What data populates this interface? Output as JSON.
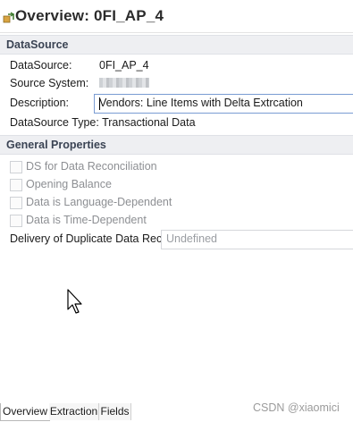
{
  "title": "Overview: 0FI_AP_4",
  "icons": {
    "title": "datasource-icon"
  },
  "datasource_section": {
    "header": "DataSource",
    "fields": {
      "datasource": {
        "label": "DataSource:",
        "value": "0FI_AP_4"
      },
      "source_system": {
        "label": "Source System:"
      },
      "description": {
        "label": "Description:",
        "value": "Vendors: Line Items with Delta Extrcation"
      },
      "datasource_type": {
        "label": "DataSource Type: Transactional Data"
      }
    }
  },
  "general_section": {
    "header": "General Properties",
    "checkboxes": [
      {
        "label": "DS for Data Reconciliation",
        "checked": false
      },
      {
        "label": "Opening Balance",
        "checked": false
      },
      {
        "label": "Data is Language-Dependent",
        "checked": false
      },
      {
        "label": "Data is Time-Dependent",
        "checked": false
      }
    ],
    "duplicate": {
      "label": "Delivery of Duplicate Data Recs.",
      "value": "Undefined"
    }
  },
  "tabs": [
    {
      "label": "Overview",
      "active": true
    },
    {
      "label": "Extraction",
      "active": false
    },
    {
      "label": "Fields",
      "active": false
    }
  ],
  "watermark": "CSDN @xiaomici"
}
